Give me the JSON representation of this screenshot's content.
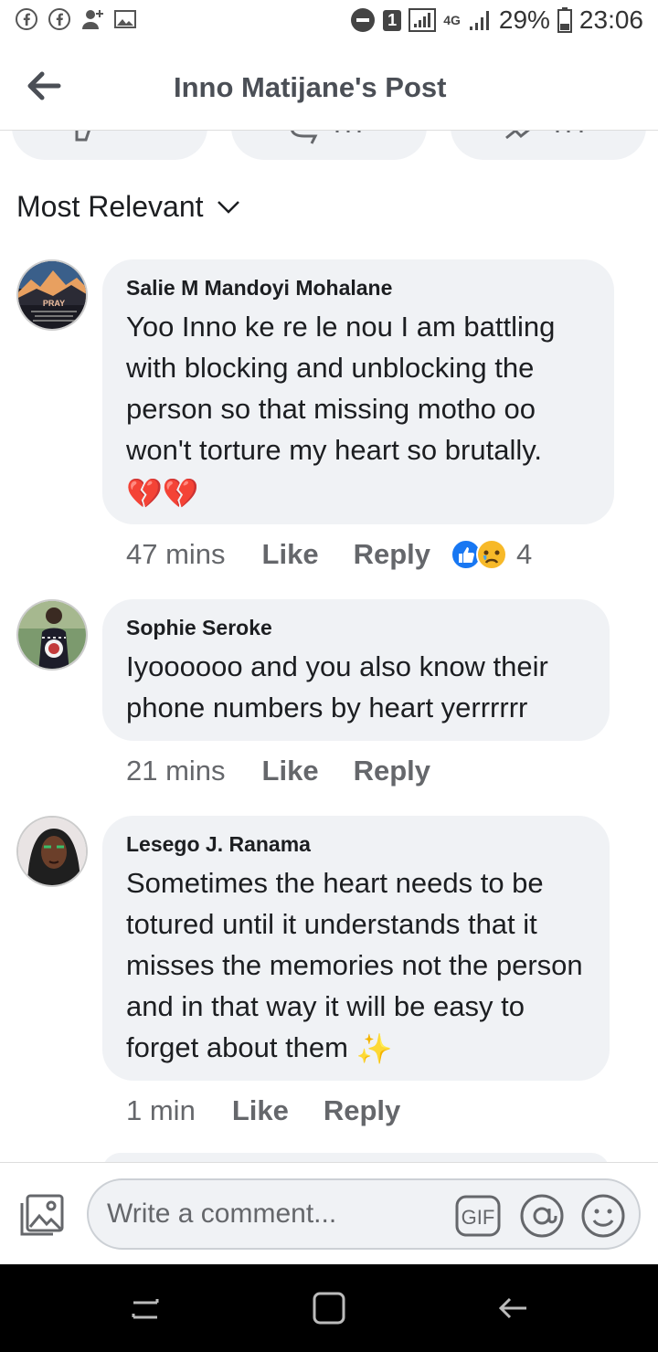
{
  "status_bar": {
    "icons_left": [
      "facebook-icon",
      "facebook-icon",
      "add-user-icon",
      "image-icon"
    ],
    "sim_badge": "1",
    "network": "4G",
    "battery": "29%",
    "time": "23:06"
  },
  "header": {
    "title": "Inno Matijane's Post"
  },
  "filter": {
    "label": "Most Relevant"
  },
  "comments": [
    {
      "author": "Salie M Mandoyi Mohalane",
      "text": "Yoo Inno ke re le nou I am battling with blocking and unblocking the person so that missing motho oo won't torture my heart so brutally.",
      "emoji": "💔💔",
      "time": "47 mins",
      "like_label": "Like",
      "reply_label": "Reply",
      "reaction_count": "4",
      "avatar_caption": "PRAY"
    },
    {
      "author": "Sophie Seroke",
      "text": "Iyoooooo and you also know their phone numbers by heart yerrrrrr",
      "time": "21 mins",
      "like_label": "Like",
      "reply_label": "Reply"
    },
    {
      "author": "Lesego J. Ranama",
      "text": "Sometimes the heart needs to be totured until it understands that it misses the memories not the person and in that way it will be easy to forget about them",
      "emoji": "✨",
      "time": "1 min",
      "like_label": "Like",
      "reply_label": "Reply"
    }
  ],
  "composer": {
    "placeholder": "Write a comment...",
    "gif_label": "GIF"
  },
  "colors": {
    "bubble": "#f0f2f5",
    "meta_text": "#65676b",
    "like_blue": "#1877f2"
  }
}
